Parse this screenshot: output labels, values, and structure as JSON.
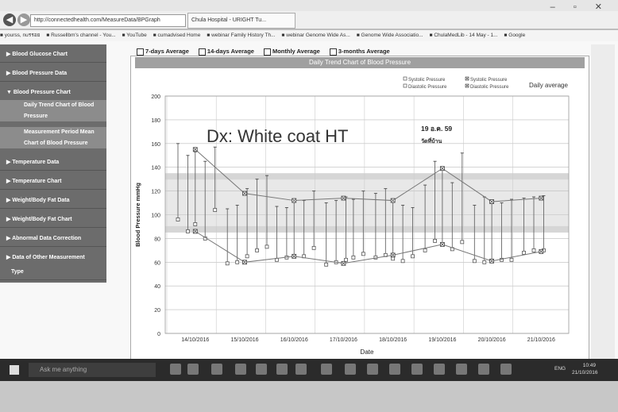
{
  "browser": {
    "address": "http://connectedhealth.com/MeasureData/BPGraph",
    "tab_title": "Chula Hospital - URIGHT Tu...",
    "favorites": [
      "yourss, nuรรอย",
      "Russellbm's channel - You...",
      "YouTube",
      "cumadvised Home",
      "webinar Family History Th...",
      "webinar Genome Wide As...",
      "Genome Wide Associatio...",
      "ChulaMedLib - 14 May - 1...",
      "Google"
    ]
  },
  "sidebar": {
    "items": [
      {
        "label": "Blood Glucose Chart"
      },
      {
        "label": "Blood Pressure Data"
      },
      {
        "label": "Blood Pressure Chart"
      },
      {
        "label": "Daily Trend Chart of Blood"
      },
      {
        "label": "Pressure"
      },
      {
        "label": "Measurement Period Mean"
      },
      {
        "label": "Chart of Blood Pressure"
      },
      {
        "label": "Temperature Data"
      },
      {
        "label": "Temperature Chart"
      },
      {
        "label": "Weight/Body Fat Data"
      },
      {
        "label": "Weight/Body Fat Chart"
      },
      {
        "label": "Abnormal Data Correction"
      },
      {
        "label": "Data of Other Measurement"
      },
      {
        "label": "Type"
      }
    ]
  },
  "averages": [
    "7-days Average",
    "14-days Average",
    "Monthly Average",
    "3-months Average"
  ],
  "chart_header": "Daily Trend Chart of Blood Pressure",
  "annotation": "Dx: White coat HT",
  "note_line1": "19 อ.ค. 59",
  "note_line2": "วัดที่บ้าน",
  "taskbar": {
    "search_placeholder": "Ask me anything",
    "time": "10:49",
    "date": "21/10/2016",
    "lang": "ENG"
  },
  "chart_data": {
    "type": "line",
    "title": "Daily Trend Chart of Blood Pressure",
    "xlabel": "Date",
    "ylabel": "Blood Pressure mmHg",
    "ylim": [
      0,
      200
    ],
    "yticks": [
      0,
      20,
      40,
      60,
      80,
      100,
      120,
      140,
      160,
      180,
      200
    ],
    "categories": [
      "14/10/2016",
      "15/10/2016",
      "16/10/2016",
      "17/10/2016",
      "18/10/2016",
      "19/10/2016",
      "20/10/2016",
      "21/10/2016"
    ],
    "reference_band": {
      "from": 85,
      "to": 135
    },
    "legend": [
      {
        "name": "Systolic Pressure",
        "marker": "open"
      },
      {
        "name": "Systolic Pressure",
        "marker": "cross"
      },
      {
        "name": "Diastolic Pressure",
        "marker": "open"
      },
      {
        "name": "Diastolic Pressure",
        "marker": "cross"
      },
      {
        "name": "Daily average"
      }
    ],
    "readings": [
      [
        0.0,
        160,
        96
      ],
      [
        0.2,
        150,
        86
      ],
      [
        0.35,
        153,
        92
      ],
      [
        0.55,
        145,
        80
      ],
      [
        0.75,
        157,
        104
      ],
      [
        1.0,
        105,
        59
      ],
      [
        1.2,
        108,
        60
      ],
      [
        1.4,
        122,
        65
      ],
      [
        1.6,
        130,
        70
      ],
      [
        1.8,
        133,
        73
      ],
      [
        2.0,
        107,
        62
      ],
      [
        2.2,
        106,
        64
      ],
      [
        2.35,
        112,
        65
      ],
      [
        2.55,
        112,
        65
      ],
      [
        2.75,
        120,
        72
      ],
      [
        3.0,
        110,
        58
      ],
      [
        3.2,
        112,
        60
      ],
      [
        3.4,
        115,
        62
      ],
      [
        3.55,
        113,
        64
      ],
      [
        3.75,
        120,
        67
      ],
      [
        4.0,
        118,
        64
      ],
      [
        4.2,
        122,
        66
      ],
      [
        4.35,
        111,
        63
      ],
      [
        4.55,
        108,
        61
      ],
      [
        4.75,
        106,
        65
      ],
      [
        5.0,
        125,
        70
      ],
      [
        5.2,
        145,
        78
      ],
      [
        5.35,
        140,
        75
      ],
      [
        5.55,
        127,
        71
      ],
      [
        5.75,
        152,
        77
      ],
      [
        6.0,
        108,
        61
      ],
      [
        6.2,
        115,
        60
      ],
      [
        6.35,
        112,
        61
      ],
      [
        6.55,
        110,
        62
      ],
      [
        6.75,
        113,
        62
      ],
      [
        7.0,
        114,
        68
      ],
      [
        7.2,
        115,
        70
      ],
      [
        7.4,
        116,
        70
      ]
    ],
    "daily_average": {
      "systolic": [
        155,
        118,
        112,
        114,
        112,
        139,
        111,
        114
      ],
      "diastolic": [
        86,
        60,
        65,
        59,
        66,
        75,
        61,
        69
      ]
    }
  }
}
